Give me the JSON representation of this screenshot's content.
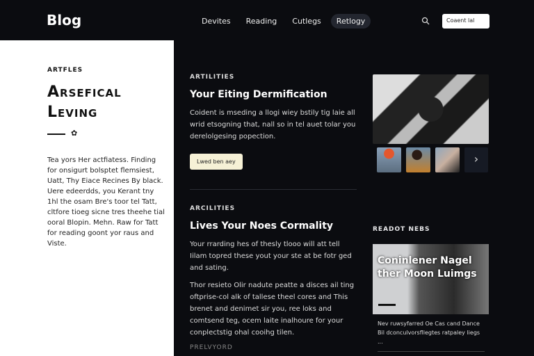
{
  "header": {
    "logo": "Blog",
    "nav": [
      "Devites",
      "Reading",
      "Cutlegs",
      "Retlogy"
    ],
    "active_nav": 3,
    "cta": "Coaent lal"
  },
  "sidebar": {
    "kicker": "ARTFLES",
    "title_line1": "Arsefical",
    "title_line2": "Leving",
    "body": "Tea yors Her actfiatess. Finding for onsigurt bolsptet flemsiest, Uatt, Thy Eiace Recines By black. Uere edeerdds, you Kerant tny 1hl the osam Bre's toor tel Tatt, cltfore tioeg sicne tres theehe tial ooral Blopin. Mehn. Raw for Tatt for reading goont yor raus and Viste."
  },
  "articles": [
    {
      "kicker": "ARTILITIES",
      "title": "Your Eiting Dermification",
      "paragraphs": [
        "Coident is mseding a llogi wiey bstily tig laie all wrid etsogning that, nall so in tel auet tolar you derelolgesing popection."
      ],
      "button": "Lwed ben aey"
    },
    {
      "kicker": "ARCILITIES",
      "title": "Lives Your Noes Cormality",
      "paragraphs": [
        "Your rrarding hes of thesly tlooo will att tell Iilam topred these yout your ste at be fotr ged and sating.",
        "Thor resieto Olir nadute peatte a disces ail ting oftprise-col alk of tallese theel cores and This brenet and denimet sir you, ree loks and comtsend teg, ocem laite inalhoure for your conplectstig ohal cooihg tilen."
      ],
      "footer": "PRELVYORD"
    }
  ],
  "gallery": {
    "next_icon": "chevron-right-icon",
    "next_glyph": "›"
  },
  "recent": {
    "heading": "READOT NEBS",
    "card_title": "Coninlener Nagel ther Moon Luimgs",
    "card_text": "Nev ruwsyfarred Oe Cas cand Dance Bil dconculvorsfllegtes ratpaley liegs ..."
  }
}
